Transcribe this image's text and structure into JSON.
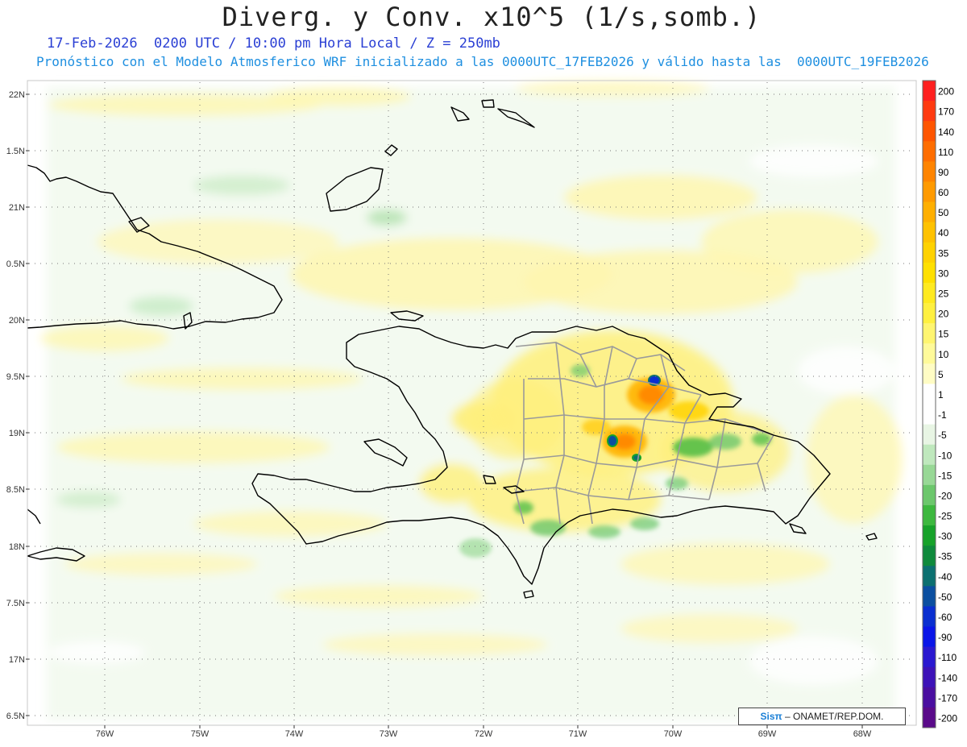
{
  "title": "Diverg. y Conv. x10^5 (1/s,somb.)",
  "subtitle_time": "17-Feb-2026  0200 UTC / 10:00 pm Hora Local / Z = 250mb",
  "subtitle_model": "Pronóstico con el Modelo Atmosferico WRF inicializado a las 0000UTC_17FEB2026 y válido hasta las  0000UTC_19FEB2026",
  "latitude_labels": [
    "22N",
    "1.5N",
    "21N",
    "0.5N",
    "20N",
    "9.5N",
    "19N",
    "8.5N",
    "18N",
    "7.5N",
    "17N",
    "6.5N"
  ],
  "longitude_labels": [
    "76W",
    "75W",
    "74W",
    "73W",
    "72W",
    "71W",
    "70W",
    "69W",
    "68W"
  ],
  "colorbar": {
    "labels": [
      "200",
      "170",
      "140",
      "110",
      "90",
      "60",
      "50",
      "40",
      "35",
      "30",
      "25",
      "20",
      "15",
      "10",
      "5",
      "1",
      "-1",
      "-5",
      "-10",
      "-15",
      "-20",
      "-25",
      "-30",
      "-35",
      "-40",
      "-50",
      "-60",
      "-90",
      "-110",
      "-140",
      "-170",
      "-200"
    ],
    "colors": [
      "#ff2020",
      "#ff3a10",
      "#ff5500",
      "#ff6d00",
      "#ff8400",
      "#ff9a00",
      "#ffaf00",
      "#ffc200",
      "#ffd200",
      "#ffe000",
      "#ffea20",
      "#fff040",
      "#fff570",
      "#fffa9a",
      "#fffcc4",
      "#ffffff",
      "#ffffff",
      "#e8f5e4",
      "#bfe8bd",
      "#98d896",
      "#6cc76c",
      "#3db83f",
      "#17a22a",
      "#0f8a3c",
      "#0c7070",
      "#0b4fa0",
      "#0a2fd0",
      "#0a15e8",
      "#2a18d0",
      "#3d12b8",
      "#4a0ea0",
      "#5a0a8a"
    ]
  },
  "credit": {
    "brand": "Sisπ",
    "text": " – ONAMET/REP.DOM."
  },
  "colors": {
    "title_text": "#222222",
    "subtitle_time": "#2a3fd4",
    "subtitle_model": "#1e8fe0",
    "coast": "#000000",
    "provinces": "#9a9a9a",
    "land_positive": "#fff59a",
    "land_negative": "#bfe8bd",
    "max_core": "#ff8a00",
    "min_core": "#0a2fd0"
  }
}
